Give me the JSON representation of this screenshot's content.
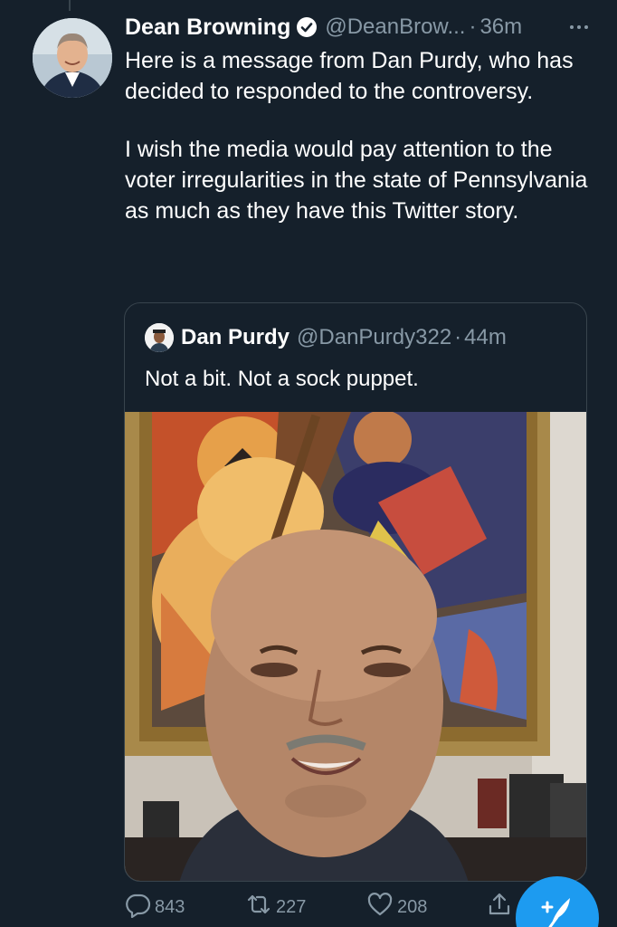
{
  "tweet": {
    "author_name": "Dean Browning",
    "handle": "@DeanBrow...",
    "dot": "·",
    "time": "36m",
    "paragraphs": [
      "Here is a message from Dan Purdy, who has decided to responded to the controversy.",
      "I wish the media would pay attention to the voter irregularities in the state of Pennsylvania as much as they have this Twitter story."
    ]
  },
  "quote": {
    "author_name": "Dan Purdy",
    "handle": "@DanPurdy322",
    "dot": "·",
    "time": "44m",
    "text": "Not a bit. Not a sock puppet."
  },
  "actions": {
    "replies": "843",
    "retweets": "227",
    "likes": "208"
  },
  "icons": [
    "verified-badge-icon",
    "more-icon",
    "reply-icon",
    "retweet-icon",
    "like-icon",
    "share-icon",
    "compose-icon"
  ],
  "colors": {
    "background": "#15202b",
    "secondary_text": "#8899a6",
    "border": "#38444d",
    "accent": "#1d9bf0"
  }
}
